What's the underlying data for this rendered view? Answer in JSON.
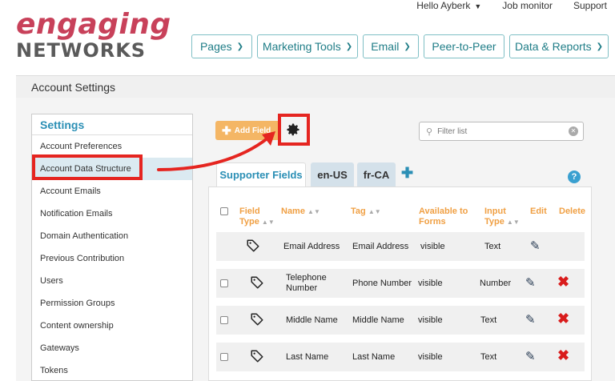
{
  "header": {
    "logo_top": "engaging",
    "logo_bottom": "NETWORKS",
    "user_menu": "Hello Ayberk",
    "job_monitor": "Job monitor",
    "support": "Support"
  },
  "nav": {
    "items": [
      {
        "label": "Pages",
        "has_dropdown": true
      },
      {
        "label": "Marketing Tools",
        "has_dropdown": true
      },
      {
        "label": "Email",
        "has_dropdown": true
      },
      {
        "label": "Peer-to-Peer",
        "has_dropdown": false
      },
      {
        "label": "Data & Reports",
        "has_dropdown": true
      }
    ]
  },
  "page_title": "Account Settings",
  "sidebar": {
    "heading": "Settings",
    "items": [
      {
        "label": "Account Preferences",
        "active": false
      },
      {
        "label": "Account Data Structure",
        "active": true
      },
      {
        "label": "Account Emails",
        "active": false
      },
      {
        "label": "Notification Emails",
        "active": false
      },
      {
        "label": "Domain Authentication",
        "active": false
      },
      {
        "label": "Previous Contribution",
        "active": false
      },
      {
        "label": "Users",
        "active": false
      },
      {
        "label": "Permission Groups",
        "active": false
      },
      {
        "label": "Content ownership",
        "active": false
      },
      {
        "label": "Gateways",
        "active": false
      },
      {
        "label": "Tokens",
        "active": false
      }
    ]
  },
  "toolbar": {
    "add_field_label": "Add Field",
    "filter_placeholder": "Filter list"
  },
  "tabs": [
    {
      "label": "Supporter Fields",
      "active": true
    },
    {
      "label": "en-US",
      "active": false
    },
    {
      "label": "fr-CA",
      "active": false
    }
  ],
  "table": {
    "headers": {
      "field_type": "Field Type",
      "name": "Name",
      "tag": "Tag",
      "available": "Available to Forms",
      "input_type": "Input Type",
      "edit": "Edit",
      "delete": "Delete"
    },
    "rows": [
      {
        "name": "Email Address",
        "tag": "Email Address",
        "available": "visible",
        "input_type": "Text",
        "selectable": false,
        "deletable": false
      },
      {
        "name": "Telephone Number",
        "tag": "Phone Number",
        "available": "visible",
        "input_type": "Number",
        "selectable": true,
        "deletable": true
      },
      {
        "name": "Middle Name",
        "tag": "Middle Name",
        "available": "visible",
        "input_type": "Text",
        "selectable": true,
        "deletable": true
      },
      {
        "name": "Last Name",
        "tag": "Last Name",
        "available": "visible",
        "input_type": "Text",
        "selectable": true,
        "deletable": true
      }
    ]
  },
  "colors": {
    "annotation_red": "#e52520",
    "brand_teal": "#1f7d87",
    "accent_orange": "#f0a044",
    "link_blue": "#2b8fb5"
  }
}
